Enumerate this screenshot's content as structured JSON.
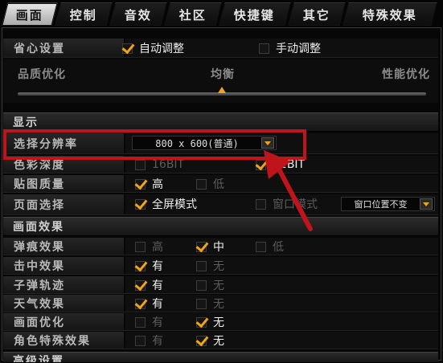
{
  "tabs": [
    {
      "label": "画面",
      "active": true
    },
    {
      "label": "控制",
      "active": false
    },
    {
      "label": "音效",
      "active": false
    },
    {
      "label": "社区",
      "active": false
    },
    {
      "label": "快捷键",
      "active": false
    },
    {
      "label": "其它",
      "active": false
    },
    {
      "label": "特殊效果",
      "active": false
    }
  ],
  "worry_free": {
    "label": "省心设置",
    "auto": {
      "label": "自动调整",
      "checked": true
    },
    "manual": {
      "label": "手动调整",
      "checked": false
    }
  },
  "slider": {
    "left_label": "品质优化",
    "mid_label": "均衡",
    "right_label": "性能优化",
    "position": 0.5
  },
  "display": {
    "title": "显示",
    "resolution": {
      "label": "选择分辨率",
      "value": "800 x 600(普通)"
    },
    "color_depth": {
      "label": "色彩深度",
      "opt1": "16BIT",
      "opt1_checked": false,
      "opt2": "32BIT",
      "opt2_checked": true
    },
    "texture": {
      "label": "贴图质量",
      "high": "高",
      "high_checked": true,
      "low": "低",
      "low_checked": false
    },
    "page_mode": {
      "label": "页面选择",
      "fullscreen": "全屏模式",
      "fullscreen_checked": true,
      "window": "窗口模式",
      "window_checked": false,
      "window_pos": "窗口位置不变"
    }
  },
  "effects": {
    "title": "画面效果",
    "rows": [
      {
        "label": "弹痕效果",
        "opts": [
          {
            "t": "高",
            "c": false
          },
          {
            "t": "中",
            "c": true
          },
          {
            "t": "低",
            "c": false
          }
        ]
      },
      {
        "label": "击中效果",
        "opts": [
          {
            "t": "有",
            "c": true
          },
          {
            "t": "无",
            "c": false
          }
        ]
      },
      {
        "label": "子弹轨迹",
        "opts": [
          {
            "t": "有",
            "c": true
          },
          {
            "t": "无",
            "c": false
          }
        ]
      },
      {
        "label": "天气效果",
        "opts": [
          {
            "t": "有",
            "c": true
          },
          {
            "t": "无",
            "c": false
          }
        ]
      },
      {
        "label": "画面优化",
        "opts": [
          {
            "t": "有",
            "c": false
          },
          {
            "t": "无",
            "c": true
          }
        ]
      },
      {
        "label": "角色特殊效果",
        "opts": [
          {
            "t": "有",
            "c": false
          },
          {
            "t": "无",
            "c": true
          }
        ]
      }
    ]
  },
  "next_section": {
    "title": "高级设置"
  },
  "colors": {
    "accent": "#f0a41a",
    "highlight": "#c0141c"
  }
}
